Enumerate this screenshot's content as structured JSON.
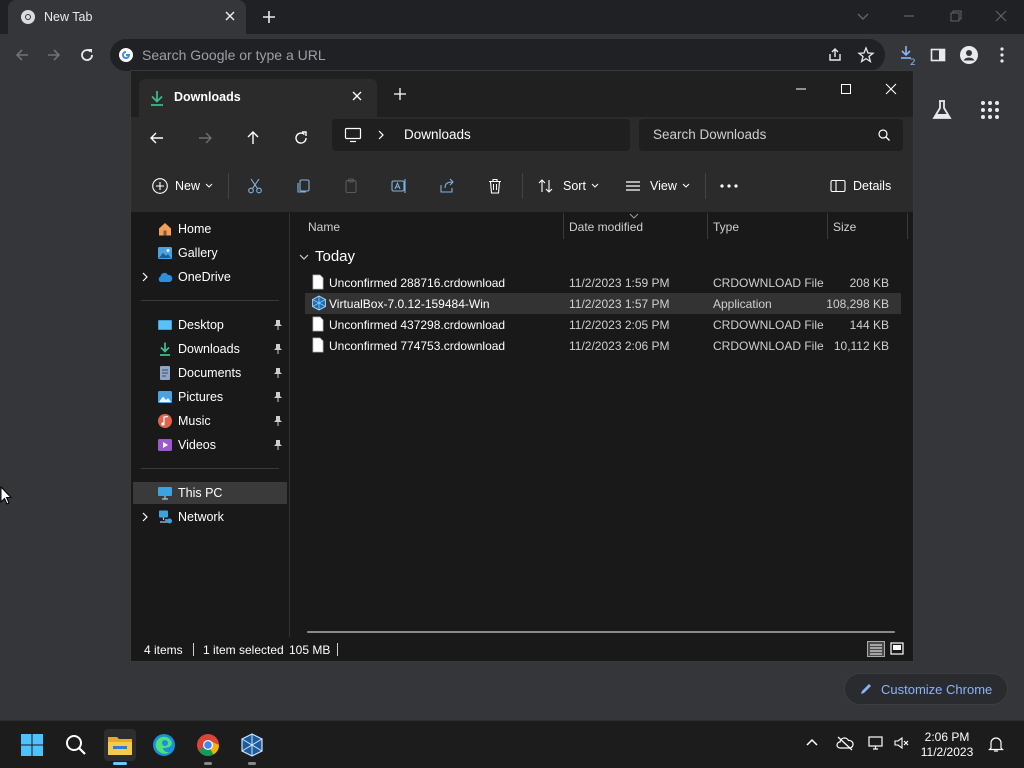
{
  "chrome": {
    "tab_title": "New Tab",
    "omnibox_placeholder": "Search Google or type a URL",
    "customize_label": "Customize Chrome"
  },
  "explorer": {
    "tab_title": "Downloads",
    "address": {
      "location": "Downloads"
    },
    "search_placeholder": "Search Downloads",
    "commands": {
      "new_label": "New",
      "sort_label": "Sort",
      "view_label": "View",
      "details_label": "Details"
    },
    "nav": {
      "home": "Home",
      "gallery": "Gallery",
      "onedrive": "OneDrive",
      "desktop": "Desktop",
      "downloads": "Downloads",
      "documents": "Documents",
      "pictures": "Pictures",
      "music": "Music",
      "videos": "Videos",
      "thispc": "This PC",
      "network": "Network"
    },
    "columns": {
      "name": "Name",
      "date": "Date modified",
      "type": "Type",
      "size": "Size"
    },
    "group_label": "Today",
    "files": [
      {
        "name": "Unconfirmed 288716.crdownload",
        "date": "11/2/2023 1:59 PM",
        "type": "CRDOWNLOAD File",
        "size": "208 KB",
        "icon": "blank-file-icon"
      },
      {
        "name": "VirtualBox-7.0.12-159484-Win",
        "date": "11/2/2023 1:57 PM",
        "type": "Application",
        "size": "108,298 KB",
        "icon": "virtualbox-icon"
      },
      {
        "name": "Unconfirmed 437298.crdownload",
        "date": "11/2/2023 2:05 PM",
        "type": "CRDOWNLOAD File",
        "size": "144 KB",
        "icon": "blank-file-icon"
      },
      {
        "name": "Unconfirmed 774753.crdownload",
        "date": "11/2/2023 2:06 PM",
        "type": "CRDOWNLOAD File",
        "size": "10,112 KB",
        "icon": "blank-file-icon"
      }
    ],
    "status": {
      "items": "4 items",
      "selected": "1 item selected",
      "size": "105 MB"
    }
  },
  "taskbar": {
    "time": "2:06 PM",
    "date": "11/2/2023"
  },
  "colors": {
    "accent": "#60cdff",
    "chrome_link": "#8ab4f8",
    "explorer_bg": "#191919",
    "selection": "#333333"
  }
}
